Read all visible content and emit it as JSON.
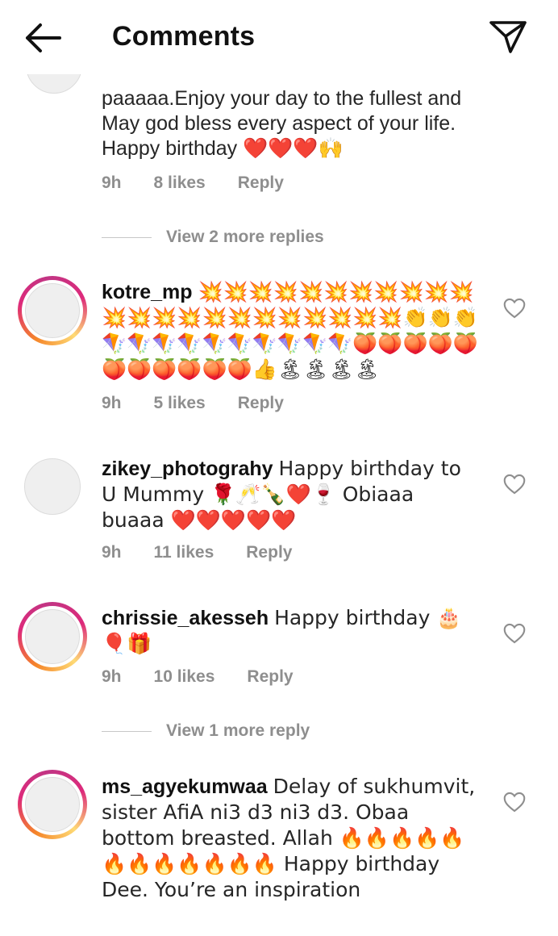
{
  "header": {
    "title": "Comments",
    "back_icon": "arrow-left-icon",
    "send_icon": "send-icon"
  },
  "comments": [
    {
      "id": "c0",
      "text": "paaaaa.Enjoy your day to the fullest and May god bless every aspect of your life. Happy birthday ❤️❤️❤️🙌",
      "time": "9h",
      "likes": "8 likes",
      "reply": "Reply"
    },
    {
      "id": "c1",
      "user": "kotre_mp",
      "text": "💥💥💥💥💥💥💥💥💥💥💥💥💥💥💥💥💥💥💥💥💥💥💥👏👏👏🪁🪁🪁🪁🪁🪁🪁🪁🪁🪁🍑🍑🍑🍑🍑🍑🍑🍑🍑🍑🍑👍🏝🏝🏝🏝",
      "time": "9h",
      "likes": "5 likes",
      "reply": "Reply"
    },
    {
      "id": "c2",
      "user": "zikey_photograhy",
      "text": "Happy birthday to U Mummy 🌹🥂🍾❤️🍷 Obiaaa buaaa ❤️❤️❤️❤️❤️",
      "time": "9h",
      "likes": "11 likes",
      "reply": "Reply"
    },
    {
      "id": "c3",
      "user": "chrissie_akesseh",
      "text": "Happy birthday 🎂🎈🎁",
      "time": "9h",
      "likes": "10 likes",
      "reply": "Reply"
    },
    {
      "id": "c4",
      "user": "ms_agyekumwaa",
      "text": "Delay of sukhumvit, sister AfiA ni3 d3 ni3 d3. Obaa bottom breasted. Allah 🔥🔥🔥🔥🔥🔥🔥🔥🔥🔥🔥🔥 Happy birthday Dee. You’re an inspiration"
    }
  ],
  "view_more_1": "View 2 more replies",
  "view_more_2": "View 1 more reply",
  "colors": {
    "meta_gray": "#8e8e8e",
    "text": "#262626",
    "story_ring": "#dd2a7b"
  }
}
